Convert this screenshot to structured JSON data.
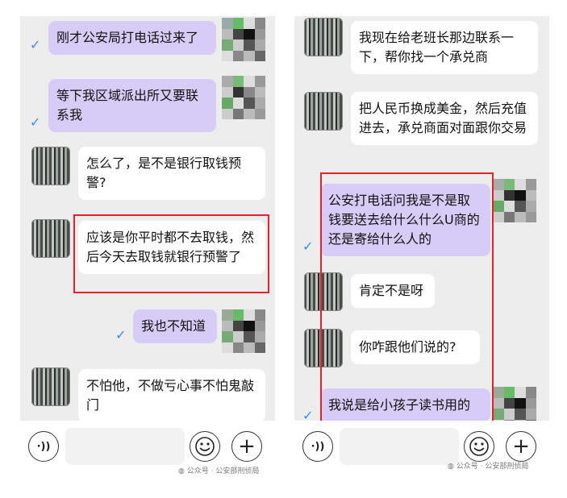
{
  "left": {
    "messages": [
      {
        "side": "out",
        "text": "刚才公安局打电话过来了"
      },
      {
        "side": "out",
        "text": "等下我区域派出所又要联系我"
      },
      {
        "side": "in",
        "text": "怎么了，是不是银行取钱预警?"
      },
      {
        "side": "in",
        "text": "应该是你平时都不去取钱，然后今天去取钱就银行预警了"
      },
      {
        "side": "out",
        "text": "我也不知道"
      },
      {
        "side": "in",
        "text": "不怕他，不做亏心事不怕鬼敲门"
      }
    ],
    "watermark": "公众号 · 公安部刑侦局"
  },
  "right": {
    "messages": [
      {
        "side": "in",
        "text": "我现在给老班长那边联系一下，帮你找一个承兑商"
      },
      {
        "side": "in",
        "text": "把人民币换成美金，然后充值进去，承兑商面对面跟你交易"
      },
      {
        "side": "out",
        "text": "公安打电话问我是不是取钱要送去给什么什么U商的还是寄给什么人的"
      },
      {
        "side": "in",
        "text": "肯定不是呀"
      },
      {
        "side": "in",
        "text": "你咋跟他们说的?"
      },
      {
        "side": "out",
        "text": "我说是给小孩子读书用的"
      }
    ],
    "watermark": "公众号 · 公安部刑侦局"
  },
  "icons": {
    "voice": "voice-icon",
    "emoji": "emoji-icon",
    "plus": "plus-icon",
    "check": "check-icon",
    "wechat": "wechat-icon"
  },
  "colors": {
    "outgoing_bubble": "#d6ccf6",
    "incoming_bubble": "#ffffff",
    "highlight_box": "#e8202a",
    "read_check": "#3a8bf0"
  },
  "glyphs": {
    "check": "✓",
    "voice": "·))",
    "plus": "+",
    "wechat": "◍"
  }
}
